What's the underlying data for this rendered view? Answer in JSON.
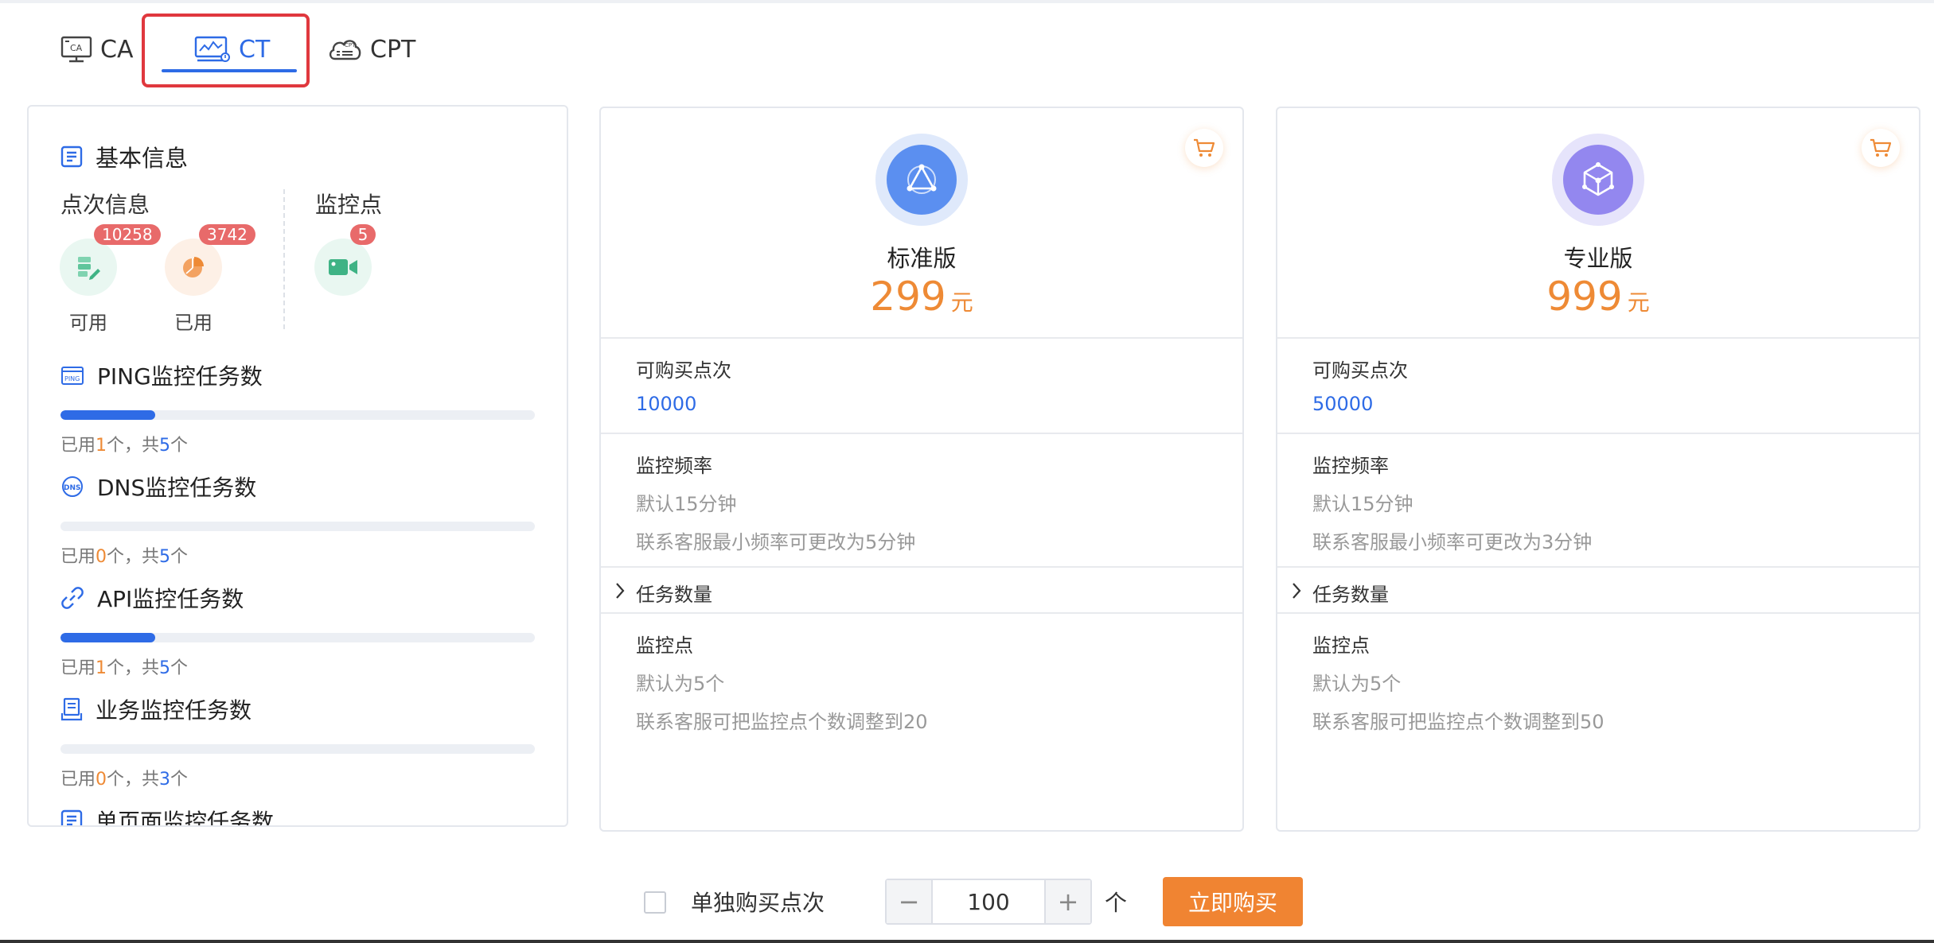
{
  "tabs": [
    {
      "label": "CA",
      "icon": "monitor-ca-icon"
    },
    {
      "label": "CT",
      "icon": "monitor-chart-icon",
      "active": true
    },
    {
      "label": "CPT",
      "icon": "cloud-cpt-icon"
    }
  ],
  "info": {
    "title": "基本信息",
    "points_title": "点次信息",
    "monitor_title": "监控点",
    "available": {
      "label": "可用",
      "badge": "10258"
    },
    "used": {
      "label": "已用",
      "badge": "3742"
    },
    "monitor_points_badge": "5",
    "usage_prefix": "已用",
    "usage_mid": "个，共",
    "usage_suffix": "个",
    "tasks": [
      {
        "title": "PING监控任务数",
        "used": "1",
        "total": "5",
        "fraction": 0.2,
        "icon": "ping-icon"
      },
      {
        "title": "DNS监控任务数",
        "used": "0",
        "total": "5",
        "fraction": 0,
        "icon": "dns-icon"
      },
      {
        "title": "API监控任务数",
        "used": "1",
        "total": "5",
        "fraction": 0.2,
        "icon": "api-link-icon"
      },
      {
        "title": "业务监控任务数",
        "used": "0",
        "total": "3",
        "fraction": 0,
        "icon": "business-icon"
      },
      {
        "title": "单页面监控任务数",
        "icon": "page-icon"
      }
    ]
  },
  "plans": [
    {
      "name": "标准版",
      "price": "299",
      "currency": "元",
      "points_title": "可购买点次",
      "points_value": "10000",
      "freq_title": "监控频率",
      "freq_default": "默认15分钟",
      "freq_note": "联系客服最小频率可更改为5分钟",
      "tasks_title": "任务数量",
      "monitor_title": "监控点",
      "monitor_default": "默认为5个",
      "monitor_note": "联系客服可把监控点个数调整到20",
      "accent": "#5b8ff0"
    },
    {
      "name": "专业版",
      "price": "999",
      "currency": "元",
      "points_title": "可购买点次",
      "points_value": "50000",
      "freq_title": "监控频率",
      "freq_default": "默认15分钟",
      "freq_note": "联系客服最小频率可更改为3分钟",
      "tasks_title": "任务数量",
      "monitor_title": "监控点",
      "monitor_default": "默认为5个",
      "monitor_note": "联系客服可把监控点个数调整到50",
      "accent": "#9387ef"
    }
  ],
  "purchase": {
    "checkbox_label": "单独购买点次",
    "quantity": "100",
    "minus": "−",
    "plus": "+",
    "unit": "个",
    "buy_label": "立即购买"
  },
  "colors": {
    "primary": "#2e6be6",
    "orange": "#ee8a35",
    "buy": "#f08432",
    "highlight": "#e0383e"
  }
}
